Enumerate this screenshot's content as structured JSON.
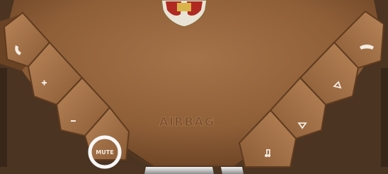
{
  "airbag_text": "AIRBAG",
  "mute_label": "MUTE",
  "buttons": {
    "left": [
      {
        "name": "phone-answer-button",
        "icon": "phone-answer-icon"
      },
      {
        "name": "volume-up-button",
        "icon": "plus-icon"
      },
      {
        "name": "volume-down-button",
        "icon": "minus-icon"
      },
      {
        "name": "mute-button",
        "icon": "mute-label"
      }
    ],
    "right": [
      {
        "name": "phone-hangup-button",
        "icon": "phone-hangup-icon"
      },
      {
        "name": "scroll-up-button",
        "icon": "triangle-up-icon"
      },
      {
        "name": "scroll-down-button",
        "icon": "triangle-down-icon"
      },
      {
        "name": "audio-source-button",
        "icon": "music-note-icon"
      }
    ]
  },
  "colors": {
    "leather": "#9b6a43",
    "leather_dark": "#6f4626",
    "button": "#a7744b",
    "button_light": "#c08a5d",
    "icon": "#f3ece3",
    "mute_ring": "#f7f7f7"
  }
}
